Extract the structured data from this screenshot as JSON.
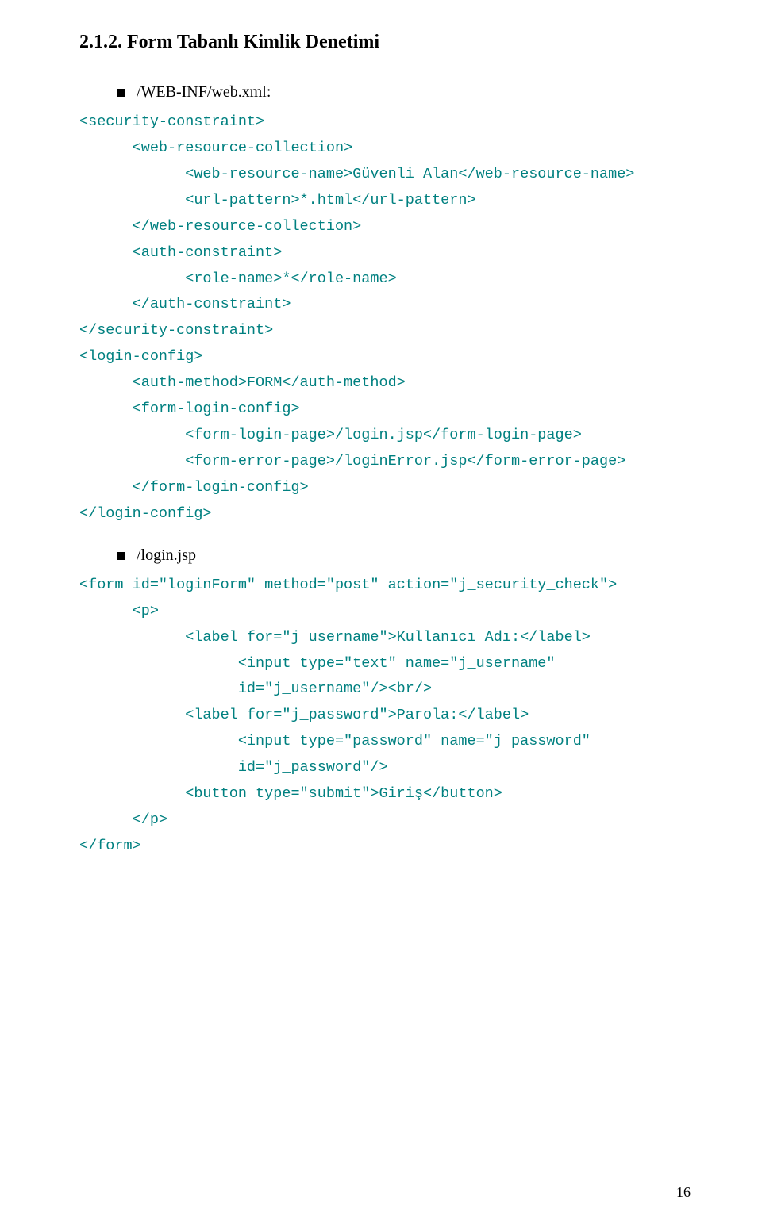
{
  "heading": "2.1.2. Form Tabanlı Kimlik Denetimi",
  "bullets": [
    {
      "label": "/WEB-INF/web.xml:"
    },
    {
      "label": "/login.jsp"
    }
  ],
  "code_block_1": "<security-constraint>\n      <web-resource-collection>\n            <web-resource-name>Güvenli Alan</web-resource-name>\n            <url-pattern>*.html</url-pattern>\n      </web-resource-collection>\n      <auth-constraint>\n            <role-name>*</role-name>\n      </auth-constraint>\n</security-constraint>\n<login-config>\n      <auth-method>FORM</auth-method>\n      <form-login-config>\n            <form-login-page>/login.jsp</form-login-page>\n            <form-error-page>/loginError.jsp</form-error-page>\n      </form-login-config>\n</login-config>",
  "code_block_2": "<form id=\"loginForm\" method=\"post\" action=\"j_security_check\">\n      <p>\n            <label for=\"j_username\">Kullanıcı Adı:</label>\n                  <input type=\"text\" name=\"j_username\"\n                  id=\"j_username\"/><br/>\n            <label for=\"j_password\">Parola:</label>\n                  <input type=\"password\" name=\"j_password\"\n                  id=\"j_password\"/>\n            <button type=\"submit\">Giriş</button>\n      </p>\n</form>",
  "page_number": "16"
}
